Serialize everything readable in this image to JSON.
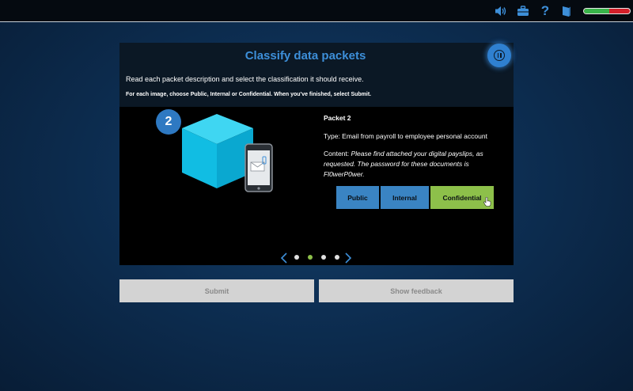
{
  "topbar": {
    "icons": [
      "speaker-icon",
      "briefcase-icon",
      "help-icon",
      "book-icon"
    ],
    "help_glyph": "?",
    "progress": {
      "value": 0.55,
      "fill_color": "#39b54a",
      "remaining_color": "#d3202a"
    }
  },
  "panel": {
    "title": "Classify data packets",
    "instruction": "Read each packet description and select the classification it should receive.",
    "instruction_bold": "For each image, choose Public, Internal or Confidential. When you've finished, select Submit.",
    "step_number": "2",
    "packet": {
      "title": "Packet 2",
      "type": "Type: Email from payroll to employee personal account",
      "content_label": "Content: ",
      "content_text": "Please find attached your digital payslips, as requested. The password for these documents is Fl0werP0wer."
    },
    "classification_buttons": {
      "public": "Public",
      "internal": "Internal",
      "confidential": "Confidential",
      "selected": "Confidential"
    },
    "pagination": {
      "total": 4,
      "current": 2
    }
  },
  "buttons": {
    "submit": "Submit",
    "show_feedback": "Show feedback"
  },
  "colors": {
    "accent_blue": "#3d8fd9",
    "button_blue": "#3a84c3",
    "selected_green": "#8dc04a",
    "cube": "#19c6ea"
  }
}
